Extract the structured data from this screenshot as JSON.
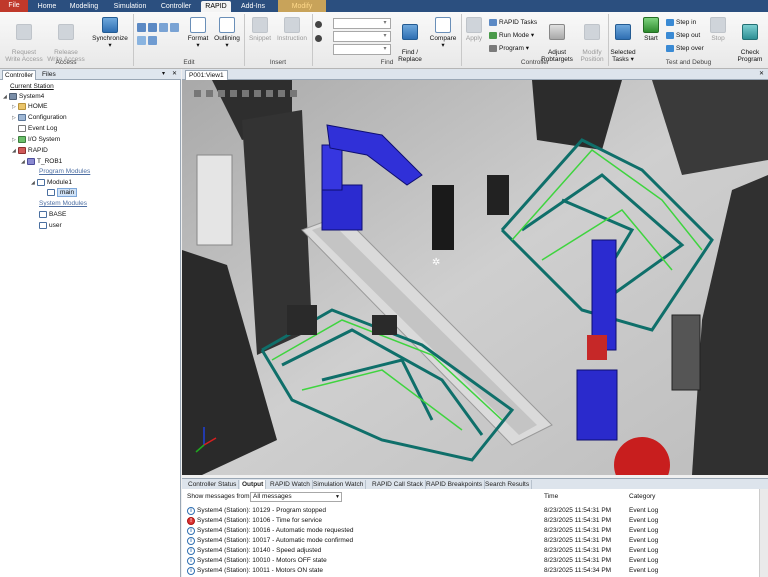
{
  "tabs": [
    {
      "label": "File"
    },
    {
      "label": "Home"
    },
    {
      "label": "Modeling"
    },
    {
      "label": "Simulation"
    },
    {
      "label": "Controller"
    },
    {
      "label": "RAPID"
    },
    {
      "label": "Add-Ins"
    },
    {
      "label": "Modify"
    }
  ],
  "ribbon": {
    "access": {
      "label": "Access",
      "request_write": "Request\nWrite Access",
      "release_write": "Release\nWrite Access"
    },
    "synchronize": "Synchronize",
    "edit": {
      "label": "Edit",
      "format": "Format",
      "outlining": "Outlining"
    },
    "insert": {
      "label": "Insert",
      "snippet": "Snippet",
      "instruction": "Instruction"
    },
    "find": {
      "label": "Find",
      "find_replace": "Find /\nReplace",
      "compare": "Compare"
    },
    "controller": {
      "label": "Controller",
      "apply": "Apply",
      "rapid_tasks": "RAPID Tasks",
      "run_mode": "Run Mode",
      "program": "Program",
      "adjust_robtargets": "Adjust\nRobtargets",
      "modify_position": "Modify\nPosition"
    },
    "test": {
      "label": "Test and Debug",
      "selected_tasks": "Selected\nTasks",
      "start": "Start",
      "step_in": "Step in",
      "step_out": "Step out",
      "step_over": "Step over",
      "stop": "Stop",
      "check_program": "Check\nProgram"
    }
  },
  "left_panel": {
    "tabs": [
      "Controller",
      "Files"
    ],
    "tree": {
      "current_station": "Current Station",
      "system": "System4",
      "home": "HOME",
      "configuration": "Configuration",
      "event_log": "Event Log",
      "io_system": "I/O System",
      "rapid": "RAPID",
      "task": "T_ROB1",
      "program_modules": "Program Modules",
      "module1": "Module1",
      "main": "main",
      "system_modules": "System Modules",
      "base": "BASE",
      "user": "user"
    }
  },
  "view": {
    "tab": "P001:View1"
  },
  "output": {
    "tabs": [
      "Controller Status",
      "Output",
      "RAPID Watch",
      "Simulation Watch",
      "RAPID Call Stack",
      "RAPID Breakpoints",
      "Search Results"
    ],
    "show_label": "Show messages from:",
    "filter_value": "All messages",
    "col_time": "Time",
    "col_category": "Category",
    "messages": [
      {
        "text": "System4 (Station): 10129 - Program stopped",
        "time": "8/23/2025 11:54:31 PM",
        "category": "Event Log",
        "icon": "info"
      },
      {
        "text": "System4 (Station): 10106 - Time for service",
        "time": "8/23/2025 11:54:31 PM",
        "category": "Event Log",
        "icon": "error"
      },
      {
        "text": "System4 (Station): 10016 - Automatic mode requested",
        "time": "8/23/2025 11:54:31 PM",
        "category": "Event Log",
        "icon": "info"
      },
      {
        "text": "System4 (Station): 10017 - Automatic mode confirmed",
        "time": "8/23/2025 11:54:31 PM",
        "category": "Event Log",
        "icon": "info"
      },
      {
        "text": "System4 (Station): 10140 - Speed adjusted",
        "time": "8/23/2025 11:54:31 PM",
        "category": "Event Log",
        "icon": "info"
      },
      {
        "text": "System4 (Station): 10010 - Motors OFF state",
        "time": "8/23/2025 11:54:31 PM",
        "category": "Event Log",
        "icon": "info"
      },
      {
        "text": "System4 (Station): 10011 - Motors ON state",
        "time": "8/23/2025 11:54:34 PM",
        "category": "Event Log",
        "icon": "info"
      }
    ]
  }
}
